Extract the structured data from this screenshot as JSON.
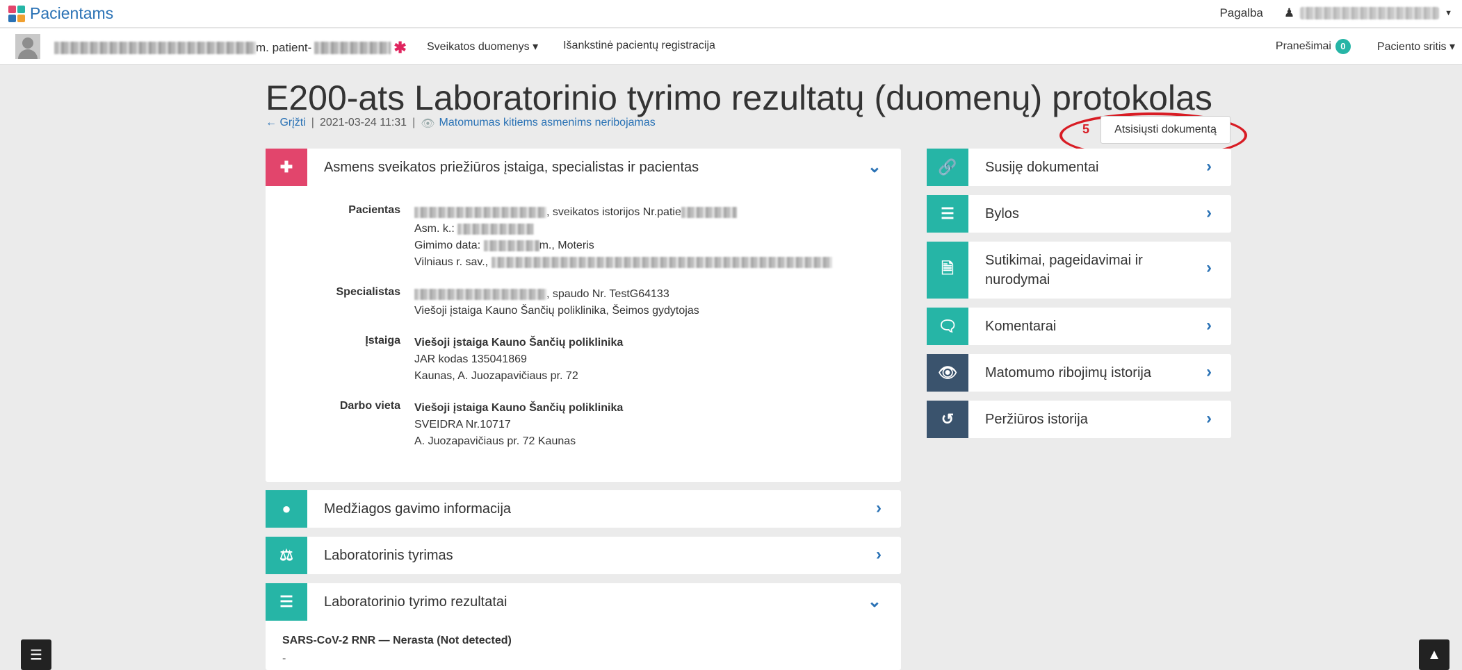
{
  "topbar": {
    "brand": "Pacientams",
    "help": "Pagalba"
  },
  "navbar": {
    "patient_suffix": "m. patient-",
    "items": [
      "Sveikatos duomenys ▾",
      "Išankstinė pacientų registracija"
    ],
    "notifications_label": "Pranešimai",
    "notifications_count": "0",
    "patient_area": "Paciento sritis ▾"
  },
  "header": {
    "title": "E200-ats Laboratorinio tyrimo rezultatų (duomenų) protokolas",
    "back": "← Grįžti",
    "datetime": "2021-03-24 11:31",
    "visibility": "Matomumas kitiems asmenims neribojamas",
    "step_number": "5",
    "download_label": "Atsisiųsti dokumentą"
  },
  "info_panel": {
    "title": "Asmens sveikatos priežiūros įstaiga, specialistas ir pacientas",
    "patient": {
      "label": "Pacientas",
      "history_prefix": ", sveikatos istorijos Nr.patie",
      "asm_k": "Asm. k.:",
      "birth_label": "Gimimo data:",
      "birth_suffix": "m., Moteris",
      "address_prefix": "Vilniaus r. sav.,"
    },
    "specialist": {
      "label": "Specialistas",
      "stamp": ", spaudo Nr. TestG64133",
      "role": "Viešoji įstaiga Kauno Šančių poliklinika, Šeimos gydytojas"
    },
    "institution": {
      "label": "Įstaiga",
      "name": "Viešoji įstaiga Kauno Šančių poliklinika",
      "jar": "JAR kodas 135041869",
      "address": "Kaunas, A. Juozapavičiaus pr. 72"
    },
    "workplace": {
      "label": "Darbo vieta",
      "name": "Viešoji įstaiga Kauno Šančių poliklinika",
      "sveidra": "SVEIDRA Nr.10717",
      "address": "A. Juozapavičiaus pr. 72 Kaunas"
    }
  },
  "left_panels": [
    {
      "title": "Medžiagos gavimo informacija"
    },
    {
      "title": "Laboratorinis tyrimas"
    },
    {
      "title": "Laboratorinio tyrimo rezultatai"
    }
  ],
  "result": {
    "text": "SARS-CoV-2 RNR — Nerasta (Not detected)",
    "dash": "-"
  },
  "right_panels": [
    {
      "title": "Susiję dokumentai"
    },
    {
      "title": "Bylos"
    },
    {
      "title": "Sutikimai, pageidavimai ir nurodymai"
    },
    {
      "title": "Komentarai"
    },
    {
      "title": "Matomumo ribojimų istorija"
    },
    {
      "title": "Peržiūros istorija"
    }
  ],
  "colors": {
    "teal": "#26b5a6",
    "pink": "#e2456c",
    "slate": "#3a536d",
    "link": "#2a72b5",
    "highlight": "#d81c24"
  }
}
